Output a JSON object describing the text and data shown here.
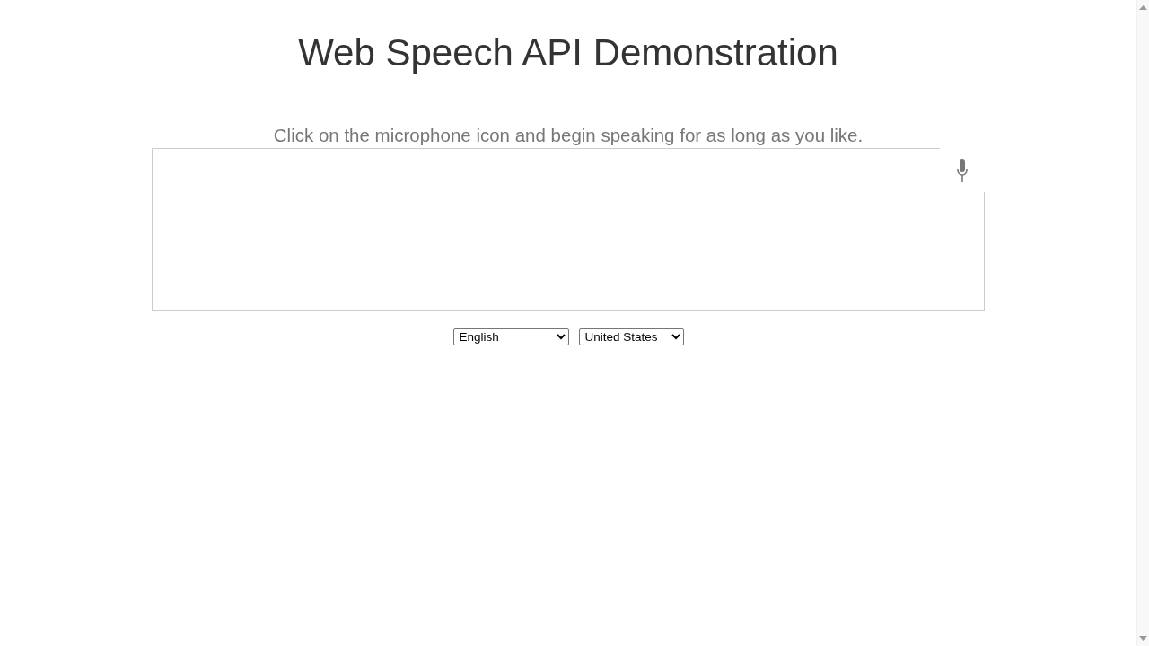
{
  "title": "Web Speech API Demonstration",
  "info": "Click on the microphone icon and begin speaking for as long as you like.",
  "selects": [
    {
      "kind": "language",
      "value": "English"
    },
    {
      "kind": "dialect",
      "value": "United States"
    }
  ]
}
